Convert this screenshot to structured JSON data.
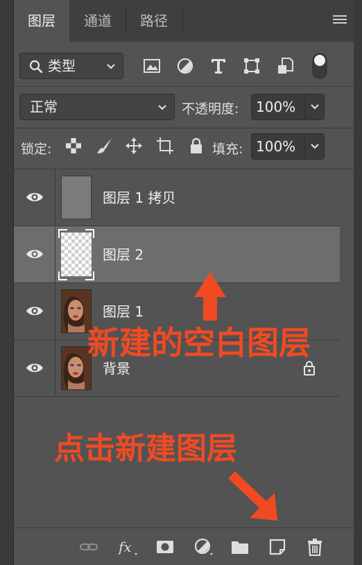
{
  "tabs": [
    {
      "label": "图层",
      "active": true
    },
    {
      "label": "通道",
      "active": false
    },
    {
      "label": "路径",
      "active": false
    }
  ],
  "filter": {
    "kind_label": "类型",
    "icons": [
      "image-filter-icon",
      "adjustment-filter-icon",
      "type-filter-icon",
      "shape-filter-icon",
      "smart-object-filter-icon",
      "filter-toggle-icon"
    ]
  },
  "blend": {
    "mode": "正常",
    "opacity_label": "不透明度:",
    "opacity_value": "100%"
  },
  "lock": {
    "label": "锁定:",
    "icons": [
      "lock-transparency-icon",
      "lock-pixels-icon",
      "lock-position-icon",
      "lock-artboard-icon",
      "lock-all-icon"
    ],
    "fill_label": "填充:",
    "fill_value": "100%"
  },
  "layers": [
    {
      "name": "图层 1 拷贝",
      "thumb": "gray",
      "visible": true,
      "selected": false,
      "locked": false
    },
    {
      "name": "图层 2",
      "thumb": "transparent",
      "visible": true,
      "selected": true,
      "locked": false
    },
    {
      "name": "图层 1",
      "thumb": "portrait",
      "visible": true,
      "selected": false,
      "locked": false
    },
    {
      "name": "背景",
      "thumb": "portrait",
      "visible": true,
      "selected": false,
      "locked": true
    }
  ],
  "annotations": {
    "new_blank_layer": "新建的空白图层",
    "click_new_layer": "点击新建图层",
    "color": "#f04a23"
  },
  "bottom_toolbar": [
    "link-layers-icon",
    "layer-style-icon",
    "add-mask-icon",
    "adjustment-layer-icon",
    "new-group-icon",
    "new-layer-icon",
    "delete-layer-icon"
  ]
}
